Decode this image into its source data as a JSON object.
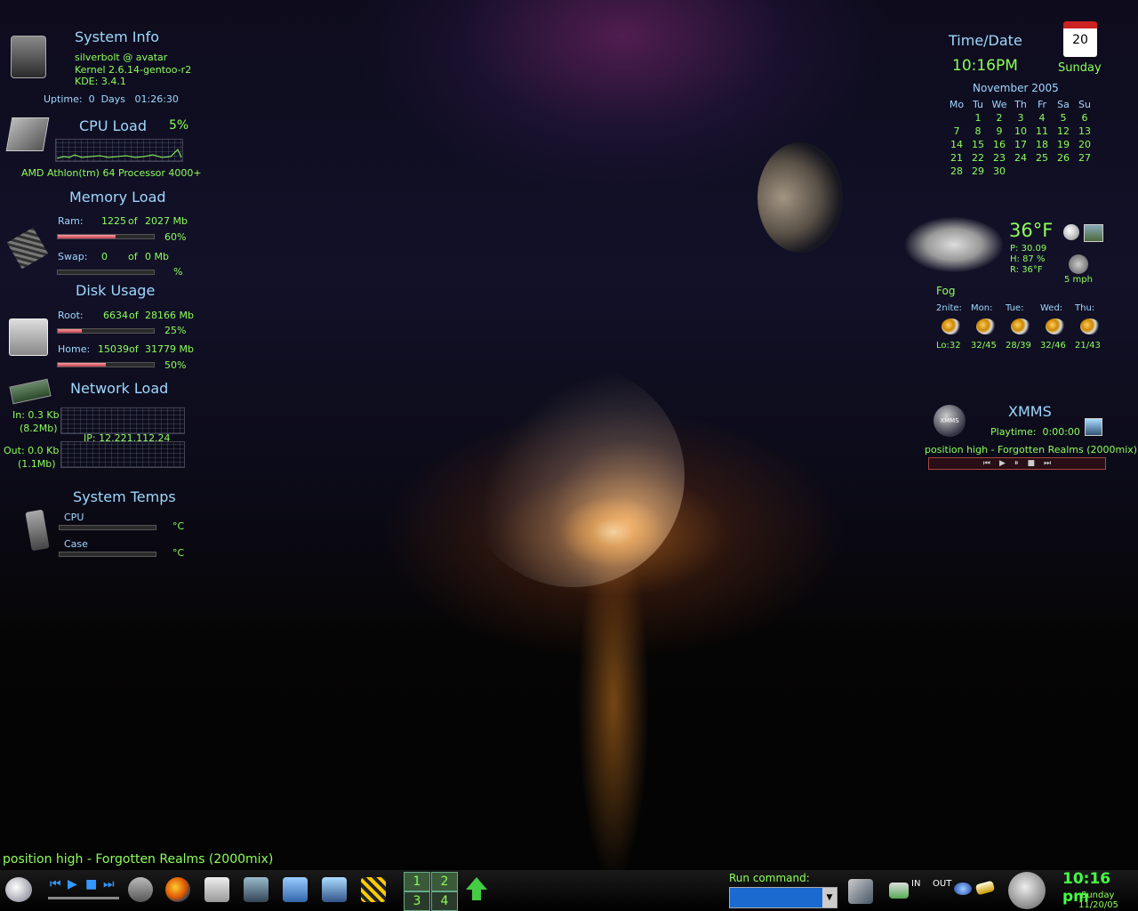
{
  "system_info": {
    "title": "System Info",
    "user_host": "silverbolt @ avatar",
    "kernel": "Kernel 2.6.14-gentoo-r2",
    "kde": "KDE: 3.4.1",
    "uptime": "Uptime:  0  Days   01:26:30"
  },
  "cpu": {
    "title": "CPU Load",
    "percent": "5%",
    "processor": "AMD Athlon(tm) 64 Processor 4000+"
  },
  "memory": {
    "title": "Memory Load",
    "ram_label": "Ram:",
    "ram_used": "1225",
    "ram_of": "of",
    "ram_total": "2027 Mb",
    "ram_percent": "60%",
    "ram_fraction": 0.6,
    "swap_label": "Swap:",
    "swap_used": "0",
    "swap_of": "of",
    "swap_total": "0 Mb",
    "swap_percent": "%"
  },
  "disk": {
    "title": "Disk Usage",
    "root_label": "Root:",
    "root_used": "6634",
    "root_of": "of",
    "root_total": "28166 Mb",
    "root_percent": "25%",
    "root_fraction": 0.25,
    "home_label": "Home:",
    "home_used": "15039",
    "home_of": "of",
    "home_total": "31779 Mb",
    "home_percent": "50%",
    "home_fraction": 0.5
  },
  "network": {
    "title": "Network Load",
    "in": "In: 0.3 Kb",
    "in_total": "(8.2Mb)",
    "out": "Out: 0.0 Kb",
    "out_total": "(1.1Mb)",
    "ip": "IP: 12.221.112.24"
  },
  "temps": {
    "title": "System Temps",
    "cpu_label": "CPU",
    "cpu_unit": "°C",
    "case_label": "Case",
    "case_unit": "°C"
  },
  "datetime": {
    "title": "Time/Date",
    "time": "10:16PM",
    "day_number": "20",
    "weekday": "Sunday",
    "month_year": "November 2005",
    "weekdays": [
      "Mo",
      "Tu",
      "We",
      "Th",
      "Fr",
      "Sa",
      "Su"
    ],
    "weeks": [
      [
        "",
        "1",
        "2",
        "3",
        "4",
        "5",
        "6"
      ],
      [
        "7",
        "8",
        "9",
        "10",
        "11",
        "12",
        "13"
      ],
      [
        "14",
        "15",
        "16",
        "17",
        "18",
        "19",
        "20"
      ],
      [
        "21",
        "22",
        "23",
        "24",
        "25",
        "26",
        "27"
      ],
      [
        "28",
        "29",
        "30",
        "",
        "",
        "",
        ""
      ]
    ]
  },
  "weather": {
    "temp": "36°F",
    "pressure": "P:  30.09",
    "humidity": "H:  87 %",
    "realfeel": "R:  36°F",
    "wind": "5 mph",
    "condition": "Fog",
    "forecast": [
      {
        "day": "2nite:",
        "temp": "Lo:32"
      },
      {
        "day": "Mon:",
        "temp": "32/45"
      },
      {
        "day": "Tue:",
        "temp": "28/39"
      },
      {
        "day": "Wed:",
        "temp": "32/46"
      },
      {
        "day": "Thu:",
        "temp": "21/43"
      }
    ]
  },
  "xmms": {
    "title": "XMMS",
    "logo_text": "XMMS",
    "playtime": "Playtime:  0:00:00",
    "track": "position high - Forgotten Realms (2000mix)",
    "controls": [
      "⏮",
      "▶",
      "⏸",
      "■",
      "⏭"
    ]
  },
  "bottom_track": "position high - Forgotten Realms (2000mix)",
  "taskbar": {
    "pager": [
      "1",
      "2",
      "3",
      "4"
    ],
    "run_command_label": "Run command:",
    "in_label": "IN",
    "out_label": "OUT",
    "clock_time": "10:16 pm",
    "clock_day": "Sunday",
    "clock_date": "11/20/05"
  },
  "colors": {
    "accent_green": "#8cff5a",
    "accent_blue": "#9fd8ff"
  }
}
